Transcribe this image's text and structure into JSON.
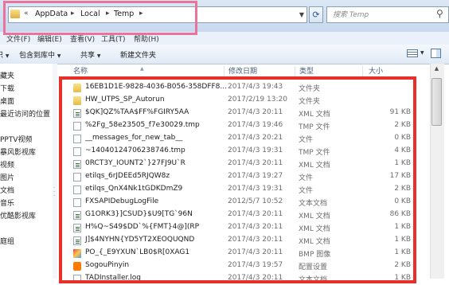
{
  "address": {
    "crumbs": [
      "AppData",
      "Local",
      "Temp"
    ],
    "search_placeholder": "搜索 Temp"
  },
  "menubar": {
    "items": [
      "文件(F)",
      "编辑(E)",
      "查看(V)",
      "工具(T)",
      "帮助(H)"
    ]
  },
  "toolbar": {
    "organize": "组织",
    "include_library": "包含到库中",
    "share": "共享",
    "new_folder": "新建文件夹"
  },
  "sidebar": {
    "items": [
      "藏夹",
      "下载",
      "桌面",
      "最近访问的位置",
      "",
      "PPTV视频",
      "暴风影视库",
      "视频",
      "图片",
      "文档",
      "音乐",
      "优酷影视库",
      "",
      "庭组"
    ]
  },
  "columns": {
    "name": "名称",
    "date": "修改日期",
    "type": "类型",
    "size": "大小"
  },
  "files": [
    {
      "icon": "folder-icon",
      "name": "16EB1D1E-9828-4036-B056-358DFF8...",
      "date": "2017/4/3 19:43",
      "type": "文件夹",
      "size": ""
    },
    {
      "icon": "folder-icon",
      "name": "HW_UTPS_SP_Autorun",
      "date": "2017/2/19 13:20",
      "type": "文件夹",
      "size": ""
    },
    {
      "icon": "xml-file-icon",
      "name": "$QK]QZ%TAA$FF%FGIRY5AA",
      "date": "2017/4/3 20:11",
      "type": "XML 文档",
      "size": "91 KB"
    },
    {
      "icon": "file-icon",
      "name": "%2Fg_58e23505_f7e30029.tmp",
      "date": "2017/4/3 19:46",
      "type": "TMP 文件",
      "size": "2 KB"
    },
    {
      "icon": "file-icon",
      "name": "__messages_for_new_tab__",
      "date": "2017/4/3 20:21",
      "type": "文件",
      "size": "0 KB"
    },
    {
      "icon": "file-icon",
      "name": "~14040124706238746.tmp",
      "date": "2017/4/3 19:31",
      "type": "TMP 文件",
      "size": "4 KB"
    },
    {
      "icon": "xml-file-icon",
      "name": "0RCT3Y_IOUNT2`}27FJ9U`R",
      "date": "2017/4/3 20:11",
      "type": "XML 文档",
      "size": "1 KB"
    },
    {
      "icon": "file-icon",
      "name": "etilqs_6rJDEEd5RJQW8z",
      "date": "2017/4/3 19:27",
      "type": "文件",
      "size": "17 KB"
    },
    {
      "icon": "file-icon",
      "name": "etilqs_QnX4Nk1tGDKDmZ9",
      "date": "2017/4/3 19:31",
      "type": "文件",
      "size": "2 KB"
    },
    {
      "icon": "file-icon",
      "name": "FXSAPIDebugLogFile",
      "date": "2012/5/7 10:52",
      "type": "文本文档",
      "size": "0 KB"
    },
    {
      "icon": "xml-file-icon",
      "name": "G1ORK3}]CSUD}$U9[TG`96N",
      "date": "2017/4/3 20:11",
      "type": "XML 文档",
      "size": "86 KB"
    },
    {
      "icon": "xml-file-icon",
      "name": "H%Q~S49$DD`%{FMT}4@](RP",
      "date": "2017/4/3 20:11",
      "type": "XML 文档",
      "size": "1 KB"
    },
    {
      "icon": "xml-file-icon",
      "name": "J]$4NYHN{YD5YT2XEOQUQND",
      "date": "2017/4/3 20:11",
      "type": "XML 文档",
      "size": "1 KB"
    },
    {
      "icon": "bmp-file-icon",
      "name": "PO_{_E9YXUN`LB0$R[0XAG1",
      "date": "2017/4/3 20:11",
      "type": "BMP 图像",
      "size": "1 KB"
    },
    {
      "icon": "sogou-icon",
      "name": "SogouPinyin",
      "date": "2017/4/3 19:57",
      "type": "配置设置",
      "size": "2 KB"
    },
    {
      "icon": "file-icon",
      "name": "TADInstaller.log",
      "date": "2017/4/3 20:11",
      "type": "文本文档",
      "size": "1 KB"
    }
  ]
}
